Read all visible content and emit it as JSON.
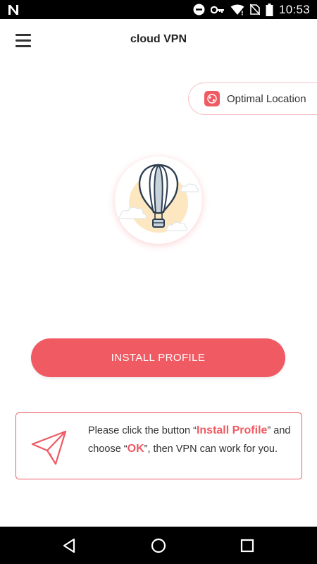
{
  "status_bar": {
    "time": "10:53",
    "icons": [
      "n-logo-icon",
      "dnd-icon",
      "key-icon",
      "wifi-icon",
      "no-sim-icon",
      "battery-icon"
    ]
  },
  "app_bar": {
    "title": "cloud VPN",
    "menu_icon": "hamburger-menu-icon"
  },
  "location": {
    "label": "Optimal Location",
    "icon": "globe-icon"
  },
  "illustration": {
    "icon": "hot-air-balloon-icon"
  },
  "install_button": {
    "label": "INSTALL PROFILE"
  },
  "hint": {
    "part1": "Please click the button “",
    "highlight1": "Install Profile",
    "part2": "” and choose “",
    "highlight2": "OK",
    "part3": "”, then VPN can work for you.",
    "icon": "paper-plane-icon"
  },
  "nav_bar": {
    "buttons": [
      "back-icon",
      "home-icon",
      "recents-icon"
    ]
  },
  "colors": {
    "accent": "#ef5a63",
    "status_bar": "#000000",
    "background": "#ffffff"
  }
}
